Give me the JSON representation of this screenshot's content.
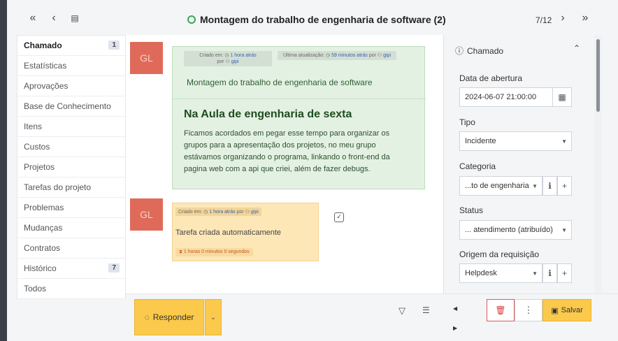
{
  "topbar": {
    "title": "Montagem do trabalho de engenharia de software (2)",
    "pager": "7/12",
    "icons": [
      "double-chevron-left-icon",
      "chevron-left-icon",
      "keyboard-icon",
      "chevron-right-icon",
      "double-chevron-right-icon"
    ],
    "status_color": "#3aa856"
  },
  "sidebar": {
    "items": [
      {
        "label": "Chamado",
        "badge": "1"
      },
      {
        "label": "Estatísticas"
      },
      {
        "label": "Aprovações"
      },
      {
        "label": "Base de Conhecimento"
      },
      {
        "label": "Itens"
      },
      {
        "label": "Custos"
      },
      {
        "label": "Projetos"
      },
      {
        "label": "Tarefas do projeto"
      },
      {
        "label": "Problemas"
      },
      {
        "label": "Mudanças"
      },
      {
        "label": "Contratos"
      },
      {
        "label": "Histórico",
        "badge": "7"
      },
      {
        "label": "Todos"
      }
    ]
  },
  "timeline": {
    "followup": {
      "avatar": "GL",
      "created_label": "Criado em:",
      "created_value": "1 hora atrás",
      "created_by_label": "por",
      "created_by": "gipi",
      "updated_label": "Última atualização:",
      "updated_value": "59 minutos atrás",
      "updated_by_label": "por",
      "updated_by": "gipi",
      "title": "Montagem do trabalho de engenharia de software",
      "heading": "Na Aula de engenharia de sexta",
      "body": "Ficamos acordados em pegar esse tempo para organizar os grupos para a apresentação dos projetos, no meu grupo estávamos organizando o programa, linkando o front-end da pagina web com a api que criei, além de fazer debugs."
    },
    "task": {
      "avatar": "GL",
      "created_label": "Criado em:",
      "created_value": "1 hora atrás",
      "created_by_label": "por",
      "created_by": "gipi",
      "text": "Tarefa criada automaticamente",
      "duration": "1 horas 0 minutos 0 segundos"
    }
  },
  "actions": {
    "reply_label": "Responder",
    "save_label": "Salvar"
  },
  "panel": {
    "header": "Chamado",
    "fields": [
      {
        "label": "Data de abertura",
        "value": "2024-06-07 21:00:00"
      },
      {
        "label": "Tipo",
        "value": "Incidente"
      },
      {
        "label": "Categoria",
        "value": "...to de engenharia"
      },
      {
        "label": "Status",
        "value": "... atendimento (atribuído)"
      },
      {
        "label": "Origem da requisição",
        "value": "Helpdesk"
      }
    ]
  },
  "colors": {
    "followup_bg": "#e3f1e3",
    "task_bg": "#fde7b7",
    "accent": "#fbc94b",
    "danger": "#e05757",
    "avatar": "#e06a5a"
  }
}
